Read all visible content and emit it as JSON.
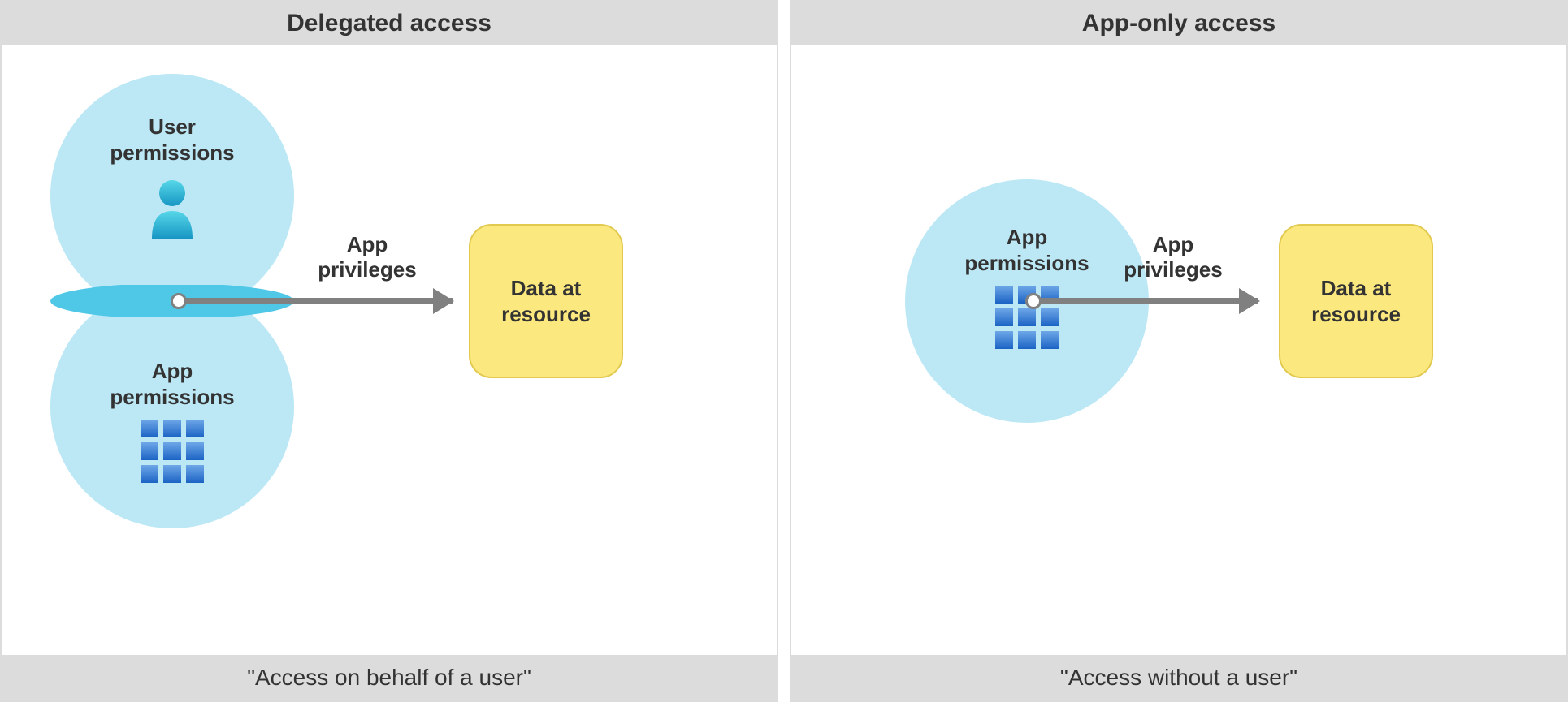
{
  "left": {
    "title": "Delegated access",
    "footer": "\"Access on behalf of a user\"",
    "user_permissions_label": "User\npermissions",
    "app_permissions_label": "App\npermissions",
    "arrow_label": "App\nprivileges",
    "data_box_label": "Data at\nresource"
  },
  "right": {
    "title": "App-only access",
    "footer": "\"Access without a user\"",
    "app_permissions_label": "App\npermissions",
    "arrow_label": "App\nprivileges",
    "data_box_label": "Data at\nresource"
  },
  "icons": {
    "user": "user-icon",
    "grid": "grid-icon"
  },
  "colors": {
    "circle_fill": "#bce8f6",
    "overlap_fill": "#4fc7e7",
    "box_fill": "#fbe87e",
    "box_border": "#e2c94f",
    "arrow": "#808080",
    "header_bg": "#dcdcdc",
    "user_icon_gradient": [
      "#57d7e8",
      "#1796c4"
    ],
    "grid_icon_gradient": [
      "#6ea7e8",
      "#1b63c4"
    ]
  }
}
